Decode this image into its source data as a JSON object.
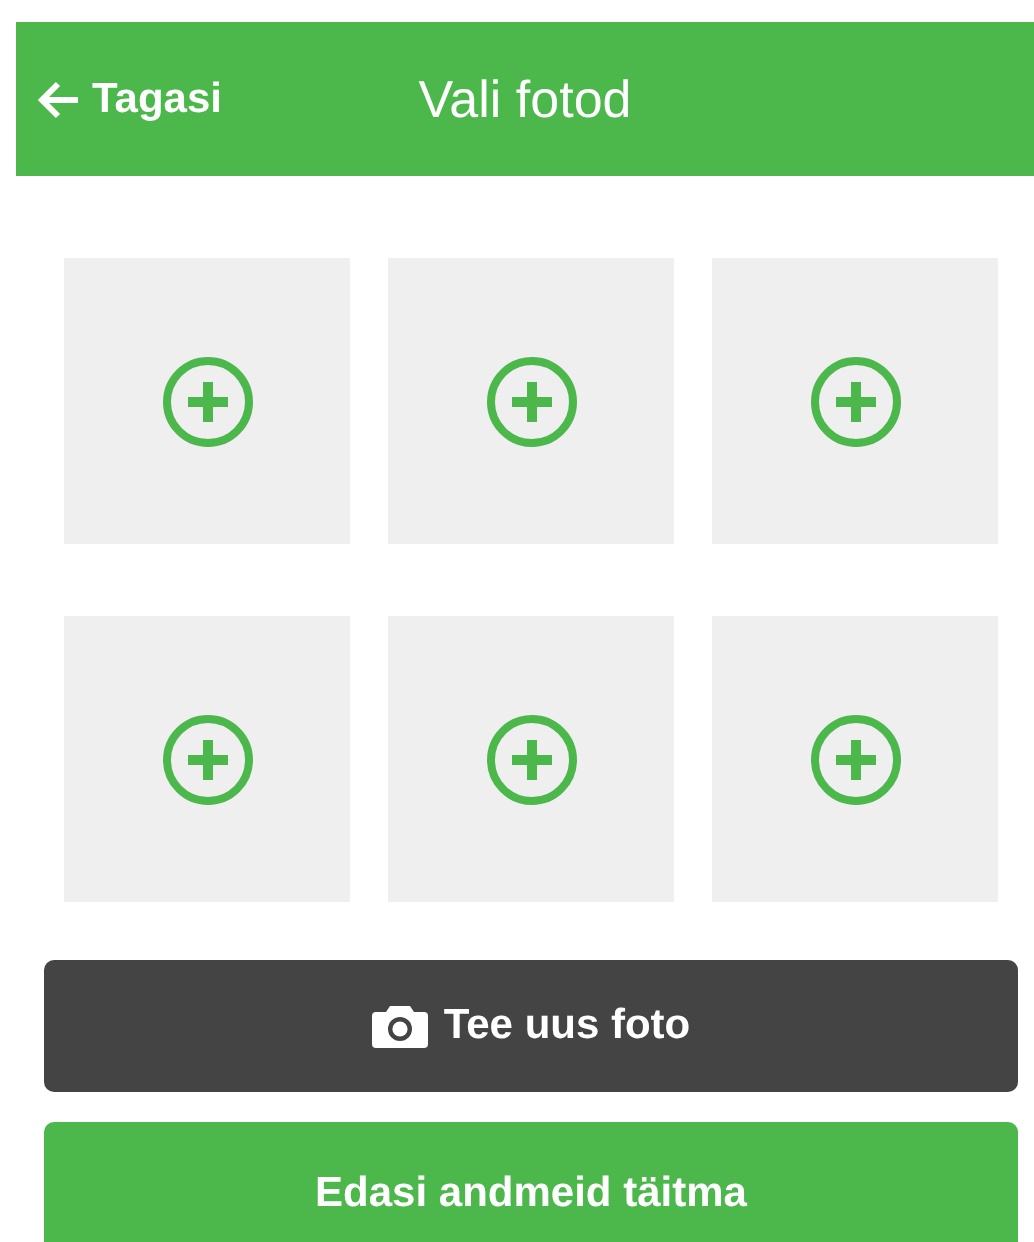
{
  "header": {
    "back_label": "Tagasi",
    "title": "Vali fotod"
  },
  "photo_slots": [
    {
      "kind": "empty"
    },
    {
      "kind": "empty"
    },
    {
      "kind": "empty"
    },
    {
      "kind": "empty"
    },
    {
      "kind": "empty"
    },
    {
      "kind": "empty"
    }
  ],
  "buttons": [
    {
      "kind": "camera",
      "label": "Tee uus foto"
    },
    {
      "kind": "primary",
      "label": "Edasi andmeid täitma"
    }
  ]
}
